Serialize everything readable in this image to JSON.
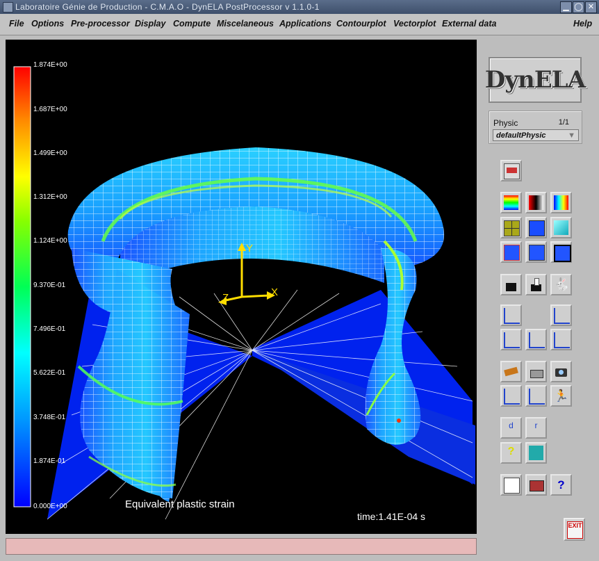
{
  "window": {
    "title": "Laboratoire Génie de Production - C.M.A.O  -  DynELA PostProcessor v 1.1.0-1"
  },
  "menu": [
    "File",
    "Options",
    "Pre-processor",
    "Display",
    "Compute",
    "Miscelaneous",
    "Applications",
    "Contourplot",
    "Vectorplot",
    "External data",
    "Help"
  ],
  "viewport": {
    "colorbar_labels": [
      "1.874E+00",
      "1.687E+00",
      "1.499E+00",
      "1.312E+00",
      "1.124E+00",
      "9.370E-01",
      "7.496E-01",
      "5.622E-01",
      "3.748E-01",
      "1.874E-01",
      "0.000E+00"
    ],
    "field_label": "Equivalent plastic strain",
    "time_label": "time:1.41E-04 s",
    "axes": {
      "x": "X",
      "y": "Y",
      "z": "Z"
    }
  },
  "panel": {
    "logo_text": "DynELA",
    "physic_label": "Physic",
    "physic_count": "1/1",
    "physic_selected": "defaultPhysic",
    "exit_label": "EXIT"
  },
  "colors": {
    "colormap": [
      "#0000ff",
      "#00aaff",
      "#00ffff",
      "#00ff66",
      "#66ff00",
      "#ffff00",
      "#ffaa00",
      "#ff3300",
      "#ff0000"
    ],
    "status_bar": "#e7b9b9"
  }
}
